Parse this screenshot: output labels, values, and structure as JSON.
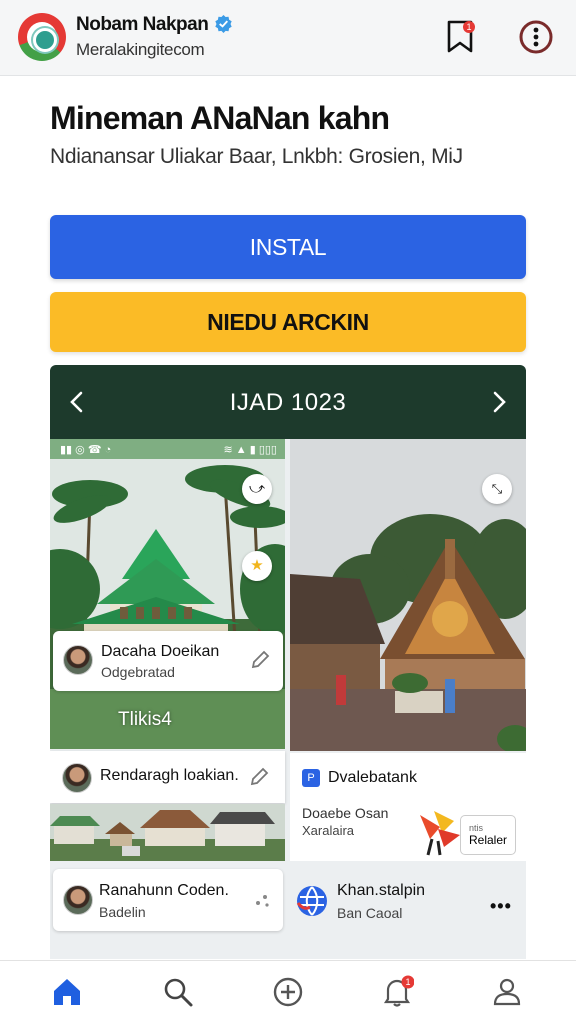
{
  "header": {
    "app_name": "Nobam Nakpan",
    "domain": "Meralakingitecom",
    "verified_icon": "verified-badge-icon",
    "bookmark_badge": "1",
    "more_icon": "more-vertical-icon"
  },
  "main": {
    "title": "Mineman ANaNan kahn",
    "subtitle": "Ndianansar Uliakar Baar, Lnkbh: Grosien, MiJ",
    "install_label": "INSTAL",
    "secondary_label": "NIEDU ARCKIN"
  },
  "datebar": {
    "label": "IJAD 1023"
  },
  "feed": {
    "statusbar_left": "▮▮ ◎ ☎ ◔",
    "statusbar_right": "≋ ▲ ▮ ▯▯▯",
    "left_photo_tag": "Tlikis4",
    "cards": [
      {
        "name": "Dacaha Doeikan",
        "sub": "Odgebratad"
      },
      {
        "name": "Rendaragh loakian.",
        "sub": ""
      },
      {
        "name": "Ranahunn Coden.",
        "sub": "Badelin"
      }
    ],
    "ad": {
      "logo": "P",
      "title": "Dvalebatank",
      "sub1": "Doaebe Osan",
      "sub2": "Xaralaira",
      "button_line1": "ntis",
      "button_line2": "Relaler"
    },
    "bottom_item": {
      "name": "Khan.stalpin",
      "sub": "Ban Caoal"
    }
  },
  "bottomnav": {
    "notification_badge": "1",
    "items": [
      "home-icon",
      "search-icon",
      "add-icon",
      "notifications-icon",
      "profile-icon"
    ]
  },
  "colors": {
    "primary": "#2b63e3",
    "secondary": "#fbbb26",
    "datebar": "#1d3a2c",
    "badge": "#e53935"
  }
}
